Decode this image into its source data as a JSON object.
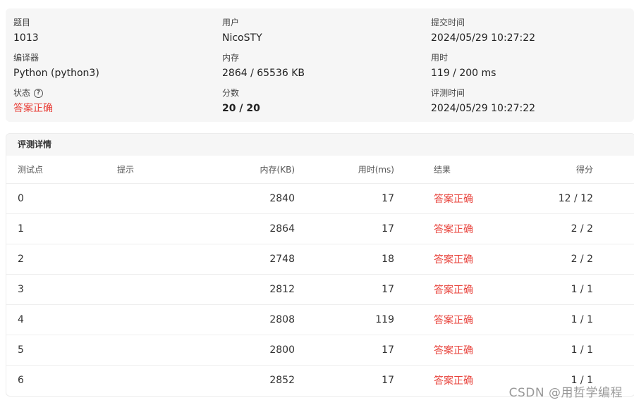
{
  "submission": {
    "problem_label": "题目",
    "problem": "1013",
    "user_label": "用户",
    "user": "NicoSTY",
    "submit_time_label": "提交时间",
    "submit_time": "2024/05/29 10:27:22",
    "compiler_label": "编译器",
    "compiler": "Python (python3)",
    "memory_label": "内存",
    "memory": "2864 / 65536 KB",
    "time_label": "用时",
    "time": "119 / 200 ms",
    "status_label": "状态",
    "status": "答案正确",
    "score_label": "分数",
    "score": "20 / 20",
    "judge_time_label": "评测时间",
    "judge_time": "2024/05/29 10:27:22"
  },
  "details": {
    "title": "评测详情",
    "headers": {
      "id": "测试点",
      "hint": "提示",
      "memory": "内存(KB)",
      "time": "用时(ms)",
      "result": "结果",
      "score": "得分"
    },
    "rows": [
      {
        "id": "0",
        "hint": "",
        "memory": "2840",
        "time": "17",
        "result": "答案正确",
        "score": "12 / 12"
      },
      {
        "id": "1",
        "hint": "",
        "memory": "2864",
        "time": "17",
        "result": "答案正确",
        "score": "2 / 2"
      },
      {
        "id": "2",
        "hint": "",
        "memory": "2748",
        "time": "18",
        "result": "答案正确",
        "score": "2 / 2"
      },
      {
        "id": "3",
        "hint": "",
        "memory": "2812",
        "time": "17",
        "result": "答案正确",
        "score": "1 / 1"
      },
      {
        "id": "4",
        "hint": "",
        "memory": "2808",
        "time": "119",
        "result": "答案正确",
        "score": "1 / 1"
      },
      {
        "id": "5",
        "hint": "",
        "memory": "2800",
        "time": "17",
        "result": "答案正确",
        "score": "1 / 1"
      },
      {
        "id": "6",
        "hint": "",
        "memory": "2852",
        "time": "17",
        "result": "答案正确",
        "score": "1 / 1"
      }
    ]
  },
  "watermark": "CSDN @用哲学编程",
  "colors": {
    "accepted": "#e8413a",
    "card_bg": "#f6f6f6"
  },
  "icons": {
    "status_help": "question-circle-icon"
  }
}
